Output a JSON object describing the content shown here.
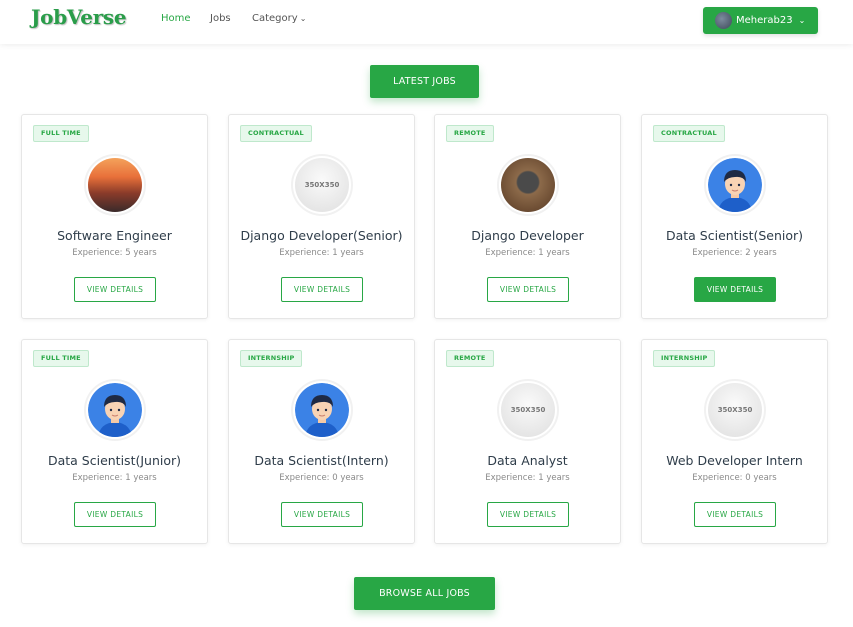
{
  "brand": "JobVerse",
  "nav": {
    "home": "Home",
    "jobs": "Jobs",
    "category": "Category"
  },
  "user": {
    "name": "Meherab23"
  },
  "latest_label": "LATEST JOBS",
  "browse_label": "BROWSE ALL JOBS",
  "jobs": [
    {
      "badge": "FULL TIME",
      "title": "Software Engineer",
      "experience": "Experience: 5 years",
      "button": "VIEW DETAILS",
      "image": "city-photo"
    },
    {
      "badge": "CONTRACTUAL",
      "title": "Django Developer(Senior)",
      "experience": "Experience: 1 years",
      "button": "VIEW DETAILS",
      "image": "placeholder",
      "placeholder_text": "350X350"
    },
    {
      "badge": "REMOTE",
      "title": "Django Developer",
      "experience": "Experience: 1 years",
      "button": "VIEW DETAILS",
      "image": "dog-photo"
    },
    {
      "badge": "CONTRACTUAL",
      "title": "Data Scientist(Senior)",
      "experience": "Experience: 2 years",
      "button": "VIEW DETAILS",
      "image": "person-avatar"
    },
    {
      "badge": "FULL TIME",
      "title": "Data Scientist(Junior)",
      "experience": "Experience: 1 years",
      "button": "VIEW DETAILS",
      "image": "person-avatar"
    },
    {
      "badge": "INTERNSHIP",
      "title": "Data Scientist(Intern)",
      "experience": "Experience: 0 years",
      "button": "VIEW DETAILS",
      "image": "person-avatar"
    },
    {
      "badge": "REMOTE",
      "title": "Data Analyst",
      "experience": "Experience: 1 years",
      "button": "VIEW DETAILS",
      "image": "placeholder",
      "placeholder_text": "350X350"
    },
    {
      "badge": "INTERNSHIP",
      "title": "Web Developer Intern",
      "experience": "Experience: 0 years",
      "button": "VIEW DETAILS",
      "image": "placeholder",
      "placeholder_text": "350X350"
    }
  ],
  "colors": {
    "accent": "#28a745",
    "badge_bg": "#e7f8ec"
  }
}
